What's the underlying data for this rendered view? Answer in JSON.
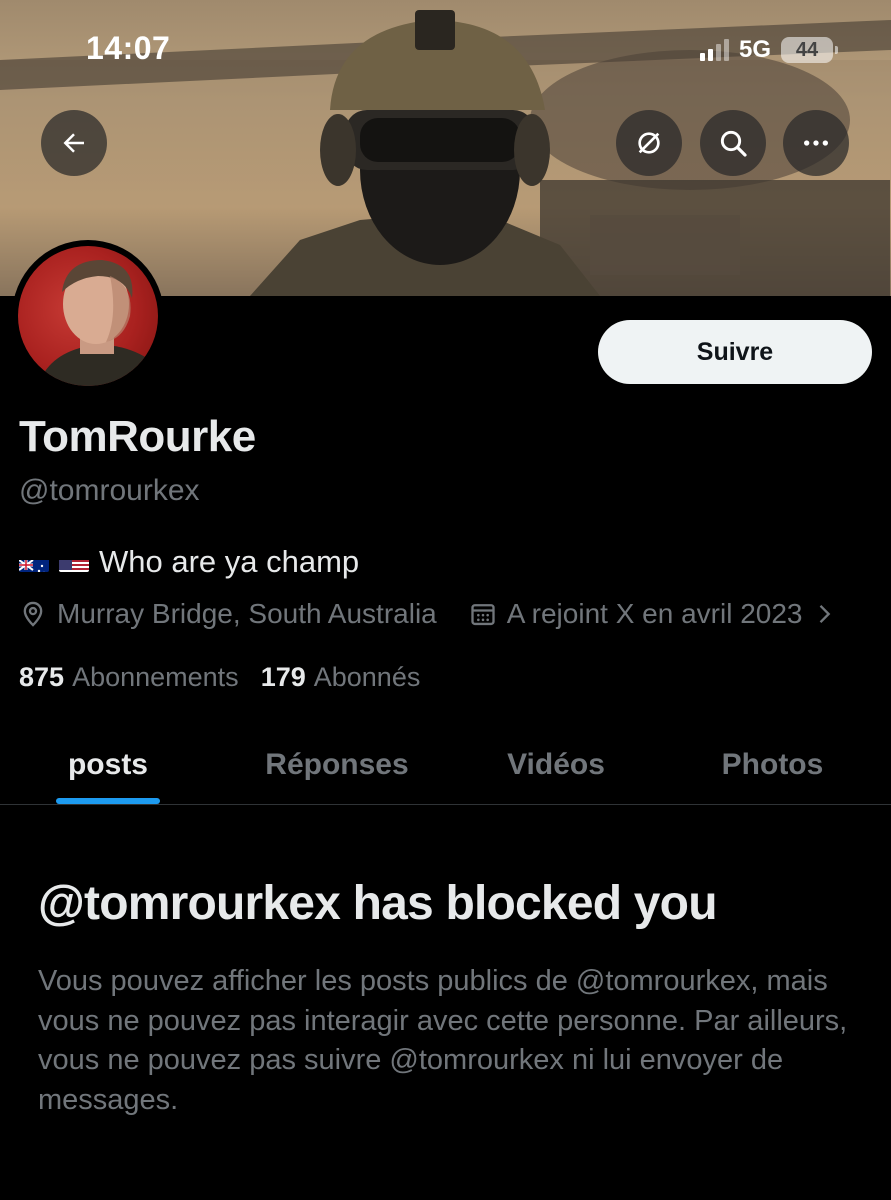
{
  "status_bar": {
    "time": "14:07",
    "network": "5G",
    "battery": "44"
  },
  "banner": {
    "back_icon": "arrow-left-icon",
    "actions": [
      "eye-slash-icon",
      "search-icon",
      "more-icon"
    ]
  },
  "profile": {
    "follow_label": "Suivre",
    "display_name": "TomRourke",
    "handle": "@tomrourkex",
    "bio_flags": [
      "AU",
      "US"
    ],
    "bio_text": "Who are ya champ",
    "location": "Murray Bridge, South Australia",
    "joined": "A rejoint X en avril 2023",
    "following_count": "875",
    "following_label": "Abonnements",
    "followers_count": "179",
    "followers_label": "Abonnés"
  },
  "tabs": [
    {
      "label": "posts",
      "active": true
    },
    {
      "label": "Réponses",
      "active": false
    },
    {
      "label": "Vidéos",
      "active": false
    },
    {
      "label": "Photos",
      "active": false
    }
  ],
  "blocked": {
    "title": "@tomrourkex has blocked you",
    "description": "Vous pouvez afficher les posts publics de @tomrourkex, mais vous ne pouvez pas interagir avec cette personne. Par ailleurs, vous ne pouvez pas suivre @tomrourkex ni lui envoyer de messages."
  },
  "colors": {
    "accent": "#1d9bf0",
    "background": "#000000",
    "primary_text": "#e7e9ea",
    "secondary_text": "#71767b",
    "avatar_background": "#b52a25"
  }
}
